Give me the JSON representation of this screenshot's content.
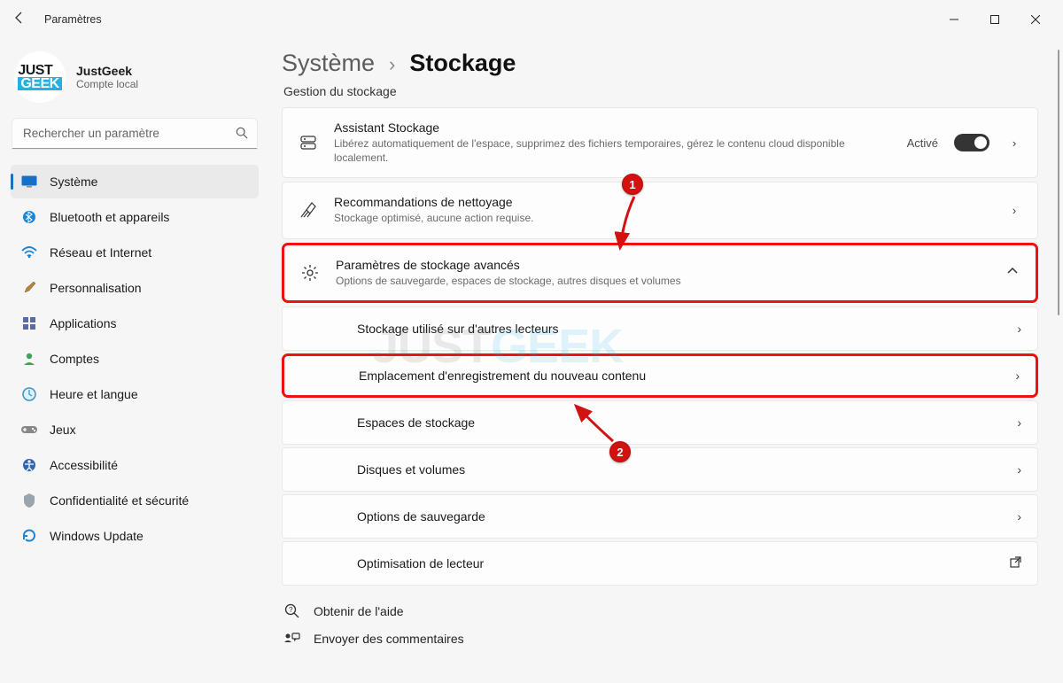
{
  "window": {
    "title": "Paramètres"
  },
  "account": {
    "name": "JustGeek",
    "subtitle": "Compte local",
    "logo_top": "JUST",
    "logo_bottom": "GEEK"
  },
  "search": {
    "placeholder": "Rechercher un paramètre"
  },
  "nav": {
    "items": [
      {
        "label": "Système"
      },
      {
        "label": "Bluetooth et appareils"
      },
      {
        "label": "Réseau et Internet"
      },
      {
        "label": "Personnalisation"
      },
      {
        "label": "Applications"
      },
      {
        "label": "Comptes"
      },
      {
        "label": "Heure et langue"
      },
      {
        "label": "Jeux"
      },
      {
        "label": "Accessibilité"
      },
      {
        "label": "Confidentialité et sécurité"
      },
      {
        "label": "Windows Update"
      }
    ]
  },
  "breadcrumb": {
    "parent": "Système",
    "current": "Stockage"
  },
  "main": {
    "section_label": "Gestion du stockage",
    "storage_sense": {
      "title": "Assistant Stockage",
      "subtitle": "Libérez automatiquement de l'espace, supprimez des fichiers temporaires, gérez le contenu cloud disponible localement.",
      "state_label": "Activé"
    },
    "cleanup": {
      "title": "Recommandations de nettoyage",
      "subtitle": "Stockage optimisé, aucune action requise."
    },
    "advanced": {
      "title": "Paramètres de stockage avancés",
      "subtitle": "Options de sauvegarde, espaces de stockage, autres disques et volumes"
    },
    "sub_items": {
      "other_drives": "Stockage utilisé sur d'autres lecteurs",
      "save_locations": "Emplacement d'enregistrement du nouveau contenu",
      "storage_spaces": "Espaces de stockage",
      "disks_volumes": "Disques et volumes",
      "backup": "Options de sauvegarde",
      "drive_optim": "Optimisation de lecteur"
    },
    "help": "Obtenir de l'aide",
    "feedback": "Envoyer des commentaires"
  },
  "annotations": {
    "callout1": "1",
    "callout2": "2"
  },
  "watermark": {
    "a": "JUST",
    "b": "GEEK"
  }
}
